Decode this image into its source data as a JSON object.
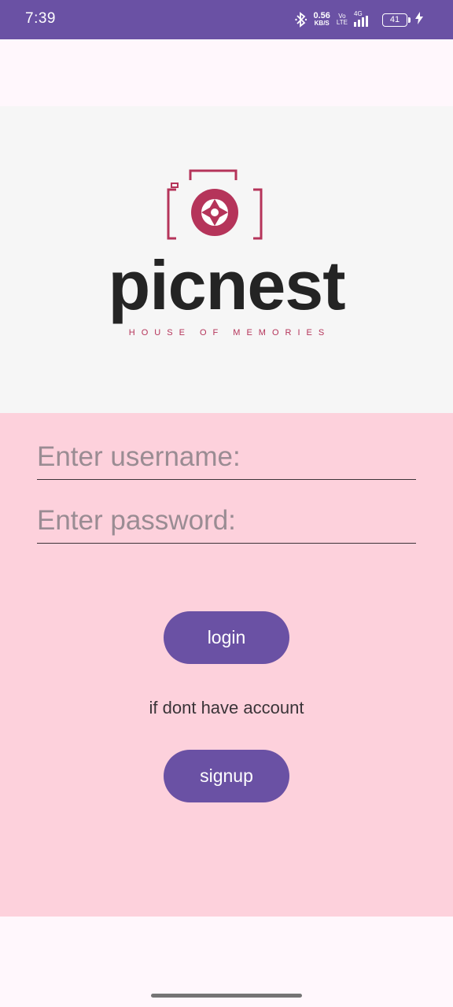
{
  "status_bar": {
    "time": "7:39",
    "net_speed_value": "0.56",
    "net_speed_unit": "KB/S",
    "volte_top": "Vo",
    "volte_bottom": "LTE",
    "network_type": "4G",
    "battery_level": "41",
    "color": "#6A51A4"
  },
  "logo": {
    "brand_name": "picnest",
    "tagline": "HOUSE OF MEMORIES",
    "icon": "camera-shutter-icon",
    "accent_color": "#B5345A"
  },
  "form": {
    "username_placeholder": "Enter username:",
    "password_placeholder": "Enter password:",
    "login_label": "login",
    "hint": "if dont have account",
    "signup_label": "signup",
    "background_color": "#FDD1DC",
    "button_color": "#6A51A4"
  }
}
